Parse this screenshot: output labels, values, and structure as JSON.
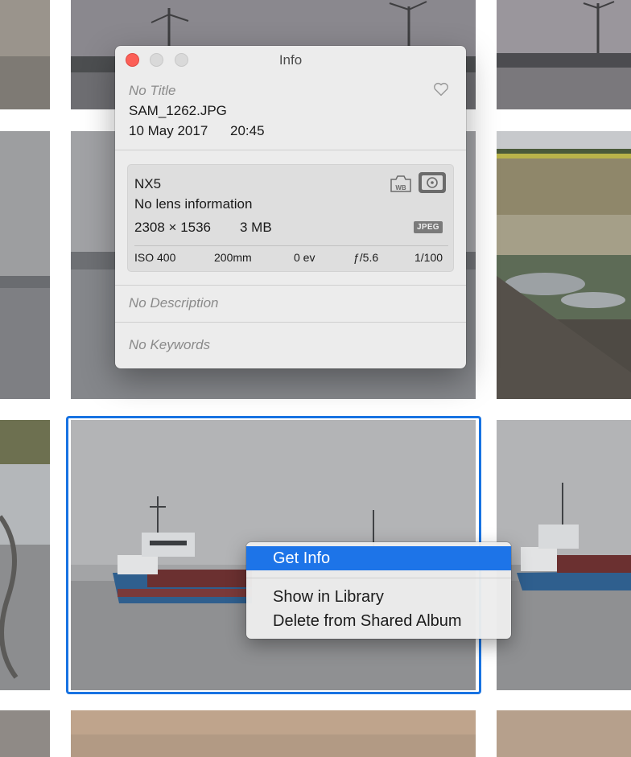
{
  "info_window": {
    "title": "Info",
    "photo_title": "No Title",
    "filename": "SAM_1262.JPG",
    "date": "10 May 2017",
    "time": "20:45",
    "camera": "NX5",
    "lens": "No lens information",
    "dimensions": "2308 × 1536",
    "file_size": "3 MB",
    "format_badge": "JPEG",
    "wb_badge": "WB",
    "iso": "ISO 400",
    "focal_length": "200mm",
    "exposure_bias": "0 ev",
    "aperture": "ƒ/5.6",
    "shutter": "1/100",
    "description_placeholder": "No Description",
    "keywords_placeholder": "No Keywords"
  },
  "context_menu": {
    "items": [
      {
        "label": "Get Info",
        "highlighted": true
      },
      {
        "label": "Show in Library",
        "highlighted": false
      },
      {
        "label": "Delete from Shared Album",
        "highlighted": false
      }
    ]
  },
  "colors": {
    "selection": "#1873e2",
    "menu_highlight": "#1d74e8",
    "close_button": "#fc5f57"
  }
}
